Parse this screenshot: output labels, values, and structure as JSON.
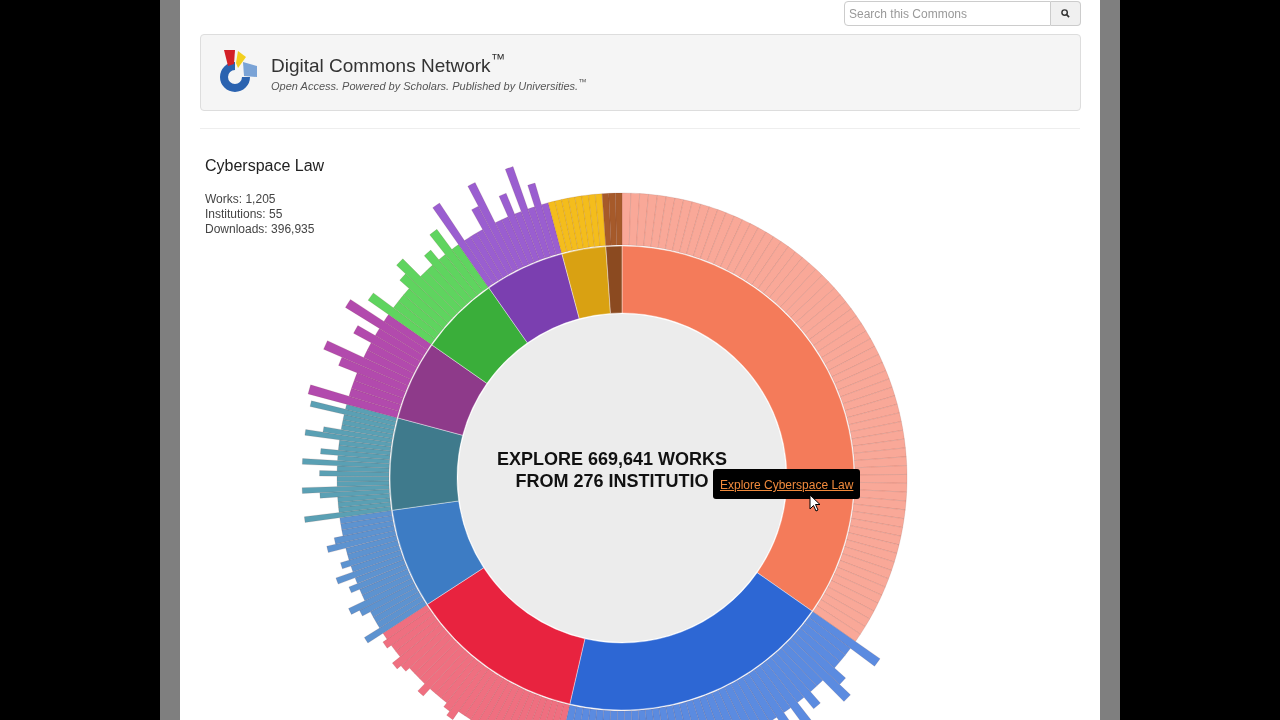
{
  "search": {
    "placeholder": "Search this Commons"
  },
  "header": {
    "title": "Digital Commons Network$^{™}$",
    "tagline": "Open Access. Powered by Scholars. Published by Universities.$^{™}$"
  },
  "discipline": {
    "title": "Cyberspace Law",
    "stats": [
      "Works: 1,205",
      "Institutions: 55",
      "Downloads: 396,935"
    ]
  },
  "center_lines": [
    "EXPLORE 669,641 WORKS",
    "FROM 276 INSTITUTIO"
  ],
  "tooltip": {
    "link": "Explore Cyberspace Law"
  }
}
